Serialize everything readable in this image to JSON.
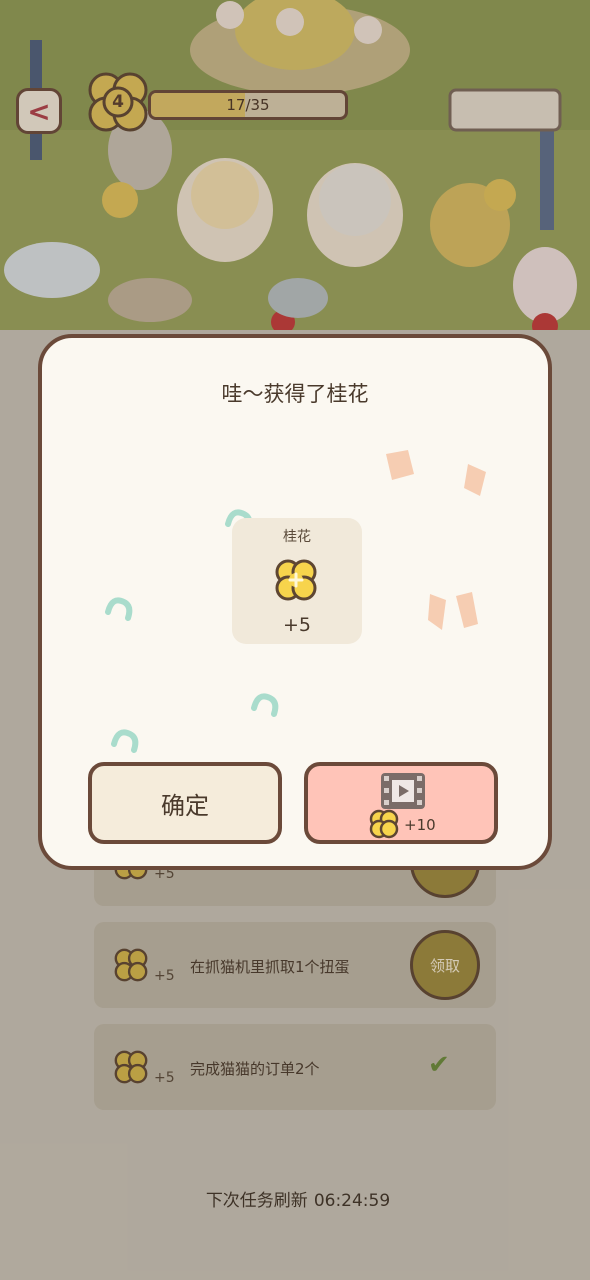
{
  "header": {
    "back_label": "<",
    "level": "4",
    "progress_text": "17/35",
    "progress_fraction": 0.486
  },
  "modal": {
    "title": "哇～获得了桂花",
    "item_name": "桂花",
    "item_amount": "+5",
    "confirm_label": "确定",
    "video_bonus": "+10",
    "video_icon": "film-play-icon"
  },
  "tasks": [
    {
      "reward": "+5",
      "text": "",
      "state": "claim",
      "claim_label": ""
    },
    {
      "reward": "+5",
      "text": "在抓猫机里抓取1个扭蛋",
      "state": "claim",
      "claim_label": "领取"
    },
    {
      "reward": "+5",
      "text": "完成猫猫的订单2个",
      "state": "done",
      "claim_label": ""
    }
  ],
  "footer": {
    "refresh_label": "下次任务刷新",
    "refresh_time": "06:24:59"
  },
  "colors": {
    "outline": "#6b4a3a",
    "flower_yellow": "#f7d44c",
    "video_button": "#ffc4b8",
    "modal_bg": "#fbf8f1"
  }
}
